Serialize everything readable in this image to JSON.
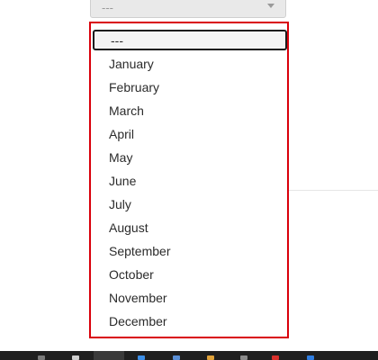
{
  "select": {
    "value": "---"
  },
  "dropdown": {
    "options": [
      "---",
      "January",
      "February",
      "March",
      "April",
      "May",
      "June",
      "July",
      "August",
      "September",
      "October",
      "November",
      "December"
    ],
    "highlighted": "---"
  },
  "colors": {
    "dropdown_border": "#d9000b",
    "highlight_border": "#1b1b1b",
    "taskbar": "#1f1f1f"
  },
  "taskbar": {
    "icons": [
      "app-icon",
      "app-icon",
      "app-icon",
      "app-icon",
      "app-icon",
      "app-icon",
      "app-icon",
      "app-icon"
    ]
  }
}
